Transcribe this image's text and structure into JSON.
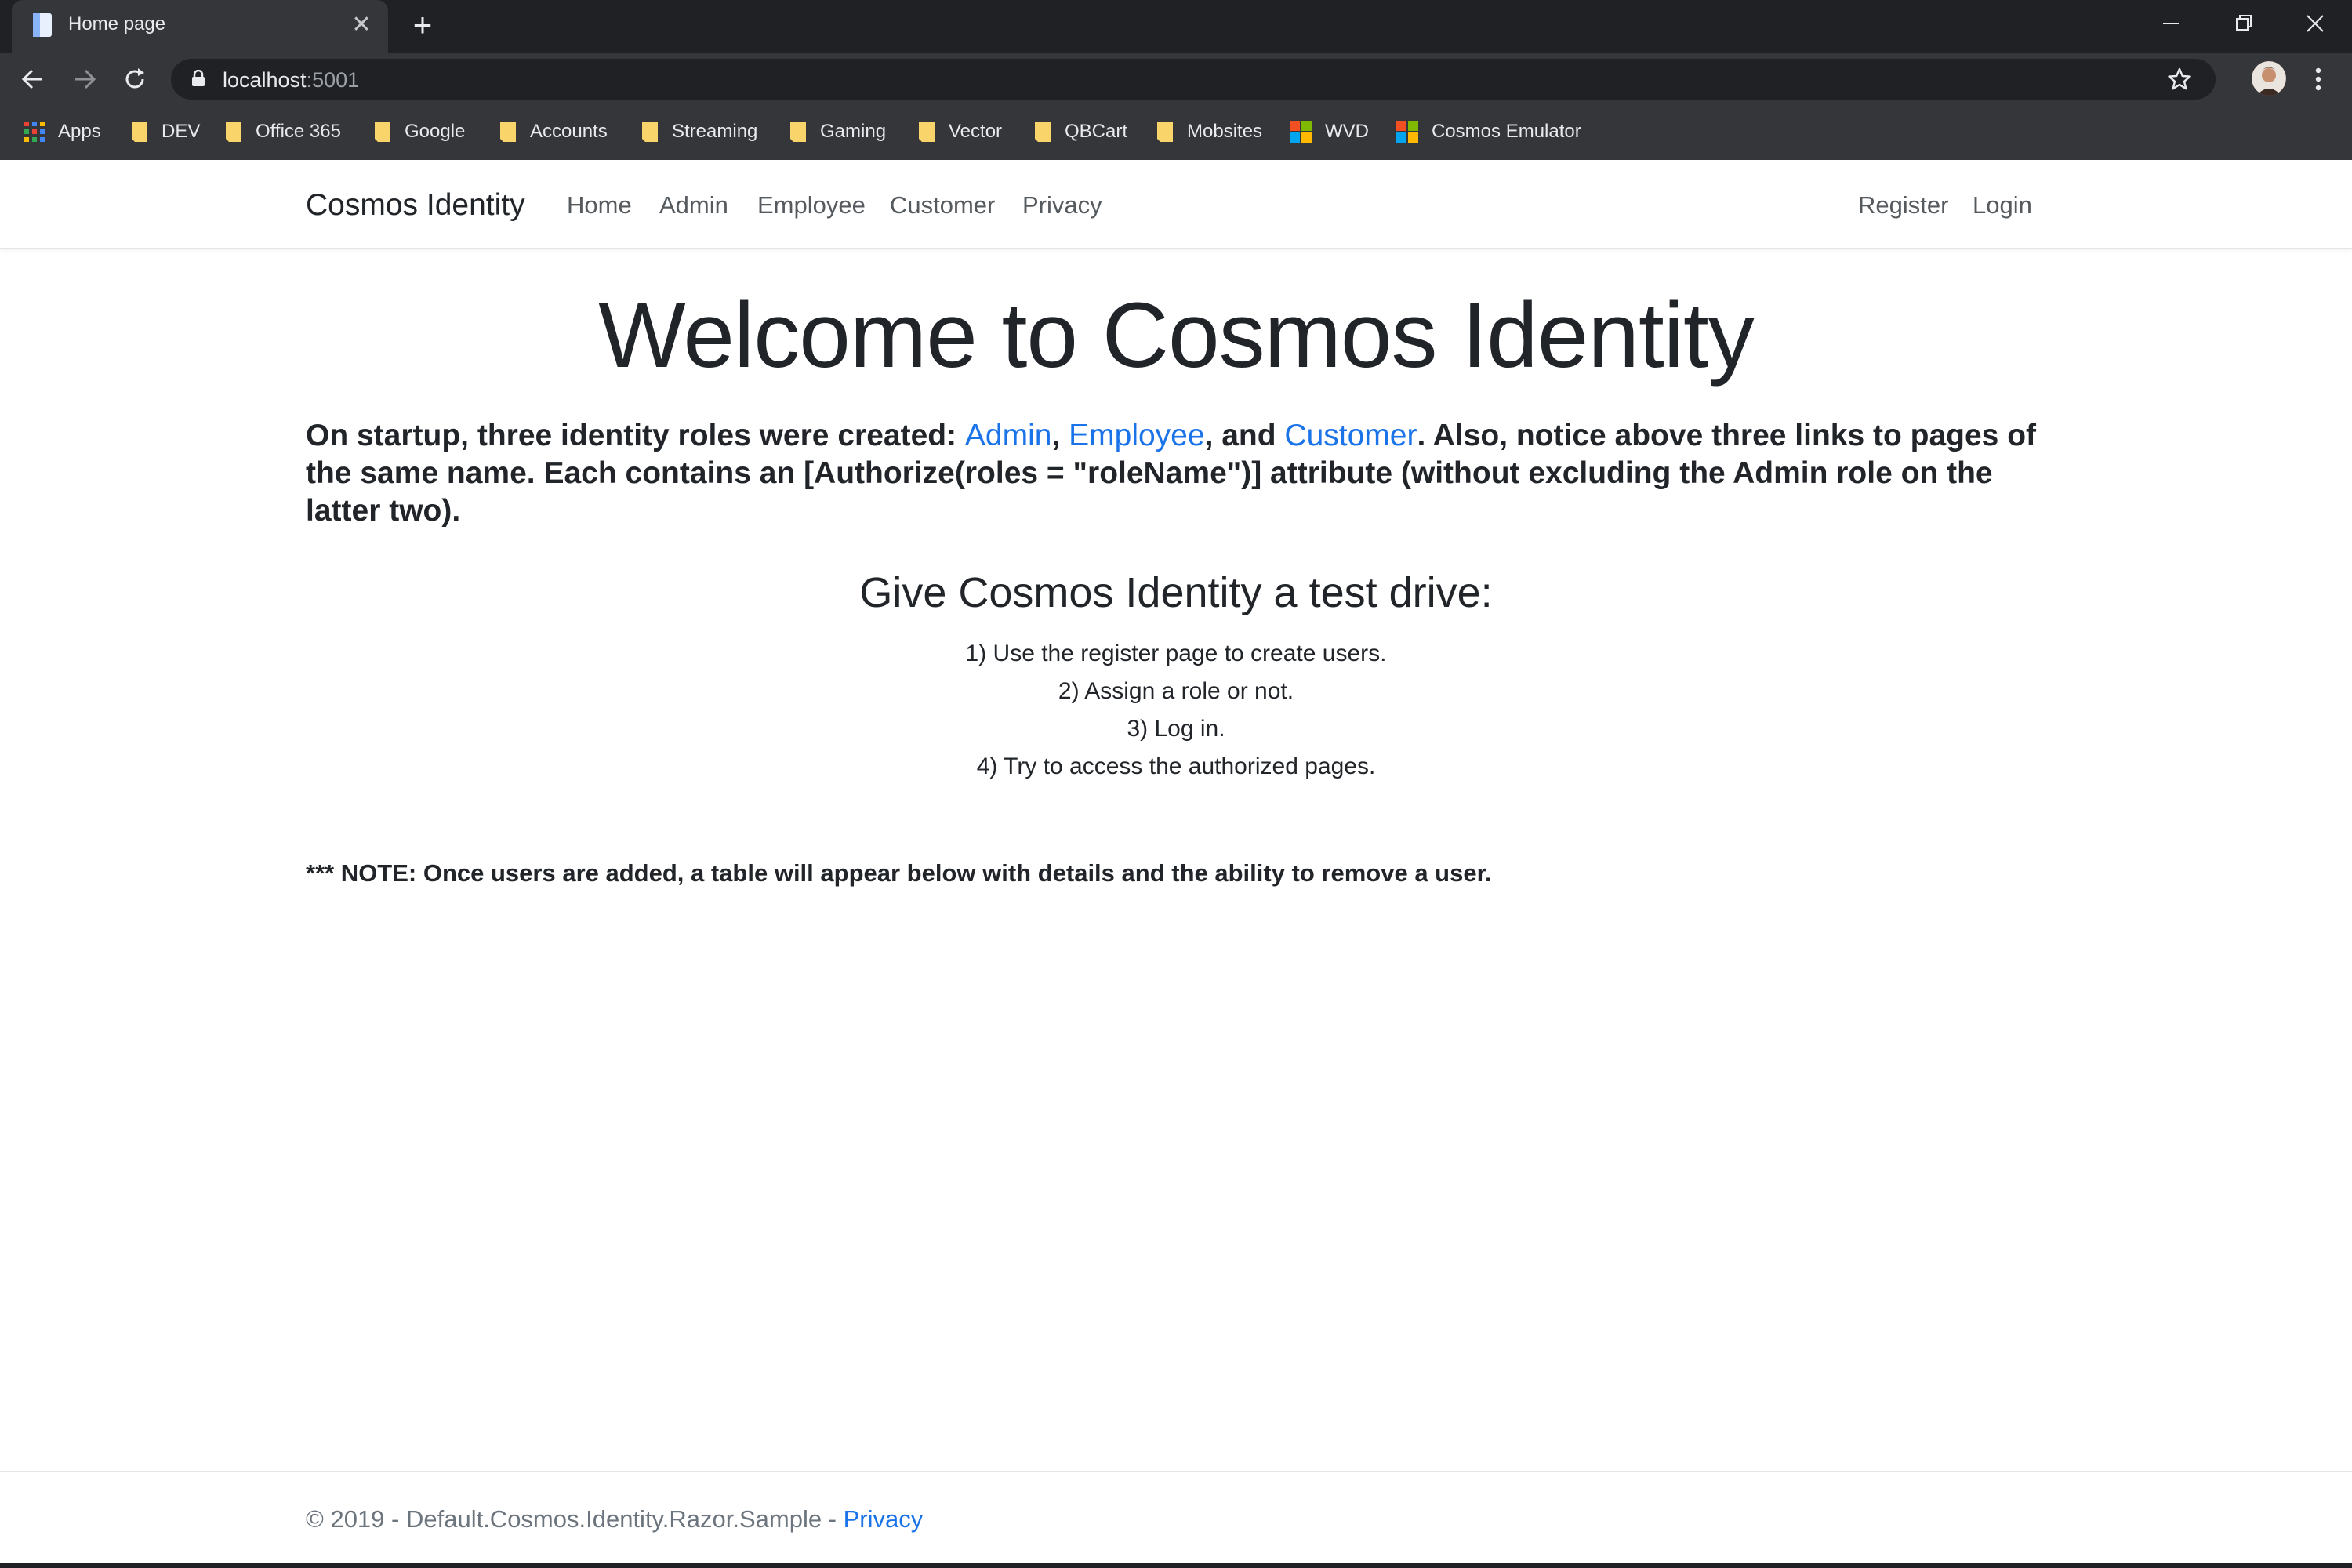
{
  "browser": {
    "tab_title": "Home page",
    "tab_close": "✕",
    "new_tab": "+",
    "url_host": "localhost",
    "url_port": ":5001",
    "bookmarks": [
      "Apps",
      "DEV",
      "Office 365",
      "Google",
      "Accounts",
      "Streaming",
      "Gaming",
      "Vector",
      "QBCart",
      "Mobsites",
      "WVD",
      "Cosmos Emulator"
    ]
  },
  "navbar": {
    "brand": "Cosmos Identity",
    "links": [
      "Home",
      "Admin",
      "Employee",
      "Customer",
      "Privacy"
    ],
    "register": "Register",
    "login": "Login"
  },
  "main": {
    "title": "Welcome to Cosmos Identity",
    "intro_prefix": "On startup, three identity roles were created: ",
    "role_admin": "Admin",
    "sep1": ", ",
    "role_employee": "Employee",
    "sep2": ", and ",
    "role_customer": "Customer",
    "intro_suffix": ". Also, notice above three links to pages of the same name. Each contains an [Authorize(roles = \"roleName\")] attribute (without excluding the Admin role on the latter two).",
    "subtitle": "Give Cosmos Identity a test drive:",
    "steps": [
      "1) Use the register page to create users.",
      "2) Assign a role or not.",
      "3) Log in.",
      "4) Try to access the authorized pages."
    ],
    "note": "*** NOTE: Once users are added, a table will appear below with details and the ability to remove a user."
  },
  "footer": {
    "text": "© 2019 - Default.Cosmos.Identity.Razor.Sample - ",
    "privacy": "Privacy"
  },
  "colors": {
    "chrome_dark": "#202124",
    "chrome_toolbar": "#35363a",
    "link_blue": "#1a73e8",
    "text": "#212529",
    "folder_yellow": "#f9d46b"
  }
}
